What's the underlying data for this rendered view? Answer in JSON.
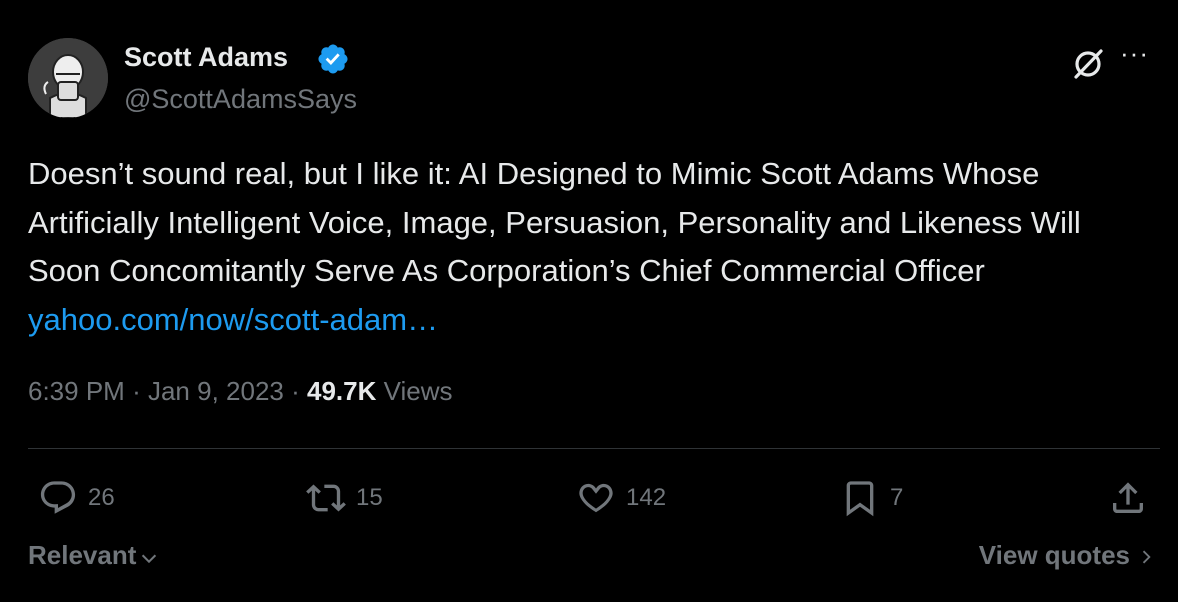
{
  "tweet": {
    "author_name": "Scott Adams",
    "author_handle": "@ScottAdamsSays",
    "text": "Doesn’t sound real, but I like it: AI Designed to Mimic Scott Adams Whose Artificially Intelligent Voice, Image, Persuasion, Personality and Likeness Will Soon Concomitantly Serve As Corporation’s Chief Commercial Officer ",
    "link_text": "yahoo.com/now/scott-adam…",
    "time": "6:39 PM",
    "separator": "·",
    "date": "Jan 9, 2023",
    "views_count": "49.7K",
    "views_label": "Views"
  },
  "actions": {
    "replies": "26",
    "retweets": "15",
    "likes": "142",
    "bookmarks": "7"
  },
  "footer": {
    "sort_label": "Relevant",
    "view_quotes_label": "View quotes"
  },
  "icons": {
    "verified": "verified-badge-icon",
    "grok": "grok-icon",
    "more": "more-icon",
    "reply": "reply-icon",
    "retweet": "retweet-icon",
    "like": "heart-icon",
    "bookmark": "bookmark-icon",
    "share": "share-icon"
  },
  "colors": {
    "background": "#000000",
    "text": "#e7e9ea",
    "secondary": "#71767b",
    "link": "#1d9bf0",
    "verified": "#1d9bf0"
  }
}
